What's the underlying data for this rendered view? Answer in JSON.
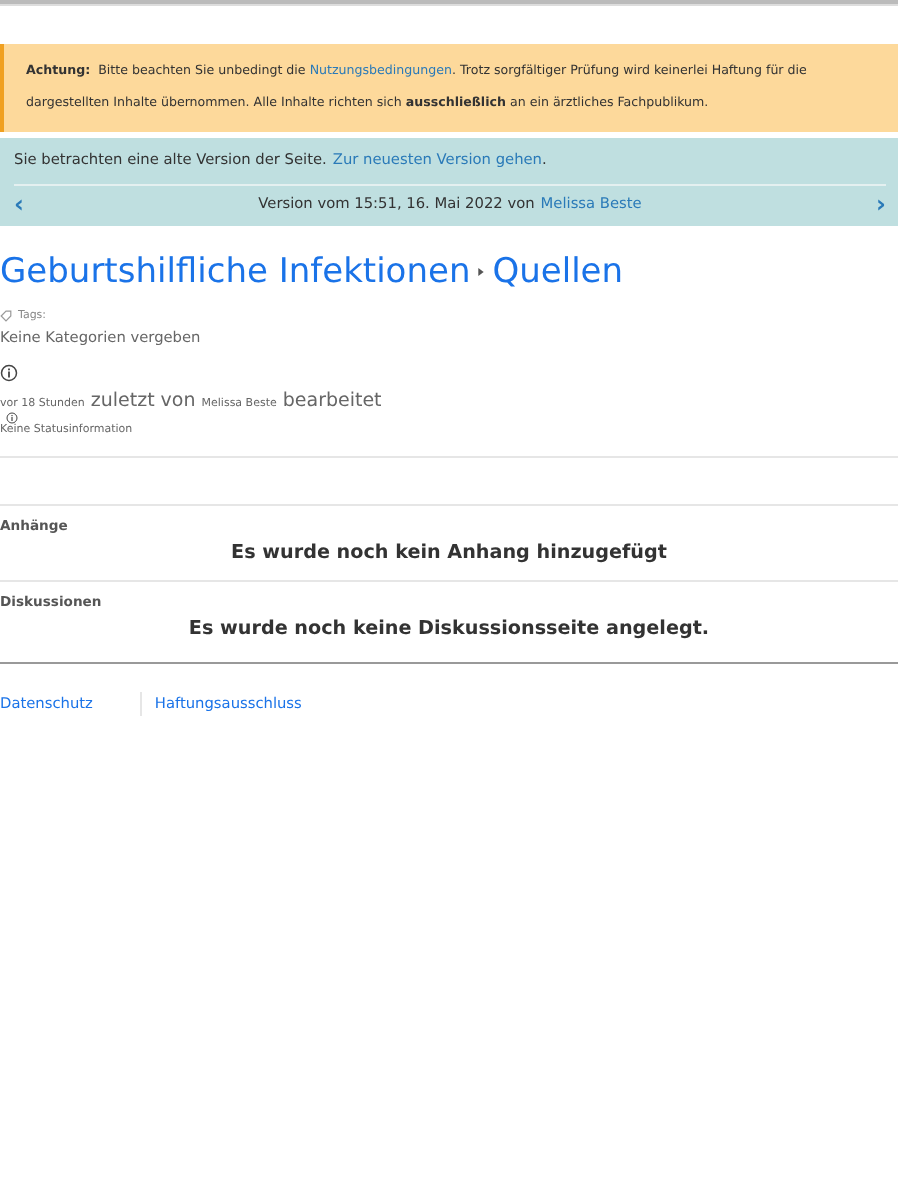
{
  "notice": {
    "label": "Achtung:",
    "text_before": "Bitte beachten Sie unbedingt die",
    "link": "Nutzungsbedingungen",
    "text_after": ". Trotz sorgfältiger Prüfung wird keinerlei Haftung für die dargestellten Inhalte übernommen. Alle Inhalte richten sich **ausschließlich** an ein ärztliches Fachpublikum."
  },
  "version_banner": {
    "text": "Sie betrachten eine alte Version der Seite.",
    "link": "Zur neuesten Version gehen",
    "link_suffix": ".",
    "version_text": "Version vom 15:51, 16. Mai 2022 von",
    "author": "Melissa Beste",
    "prev_icon": "‹",
    "next_icon": "›"
  },
  "breadcrumb": [
    {
      "label": "Geburtshilfliche Infektionen"
    },
    {
      "label": "Quellen"
    }
  ],
  "tags": {
    "label": "Tags:",
    "value": "Keine Kategorien vergeben"
  },
  "edit_info": {
    "time": "vor 18 Stunden",
    "middle": "zuletzt von",
    "author": "Melissa Beste",
    "end": "bearbeitet",
    "status": "Keine Statusinformation"
  },
  "sections": [
    {
      "title": "Anhänge",
      "message": "Es wurde noch kein Anhang hinzugefügt"
    },
    {
      "title": "Diskussionen",
      "message": "Es wurde noch keine Diskussionsseite angelegt."
    }
  ],
  "footer_links": [
    "Datenschutz",
    "Haftungsausschluss"
  ]
}
